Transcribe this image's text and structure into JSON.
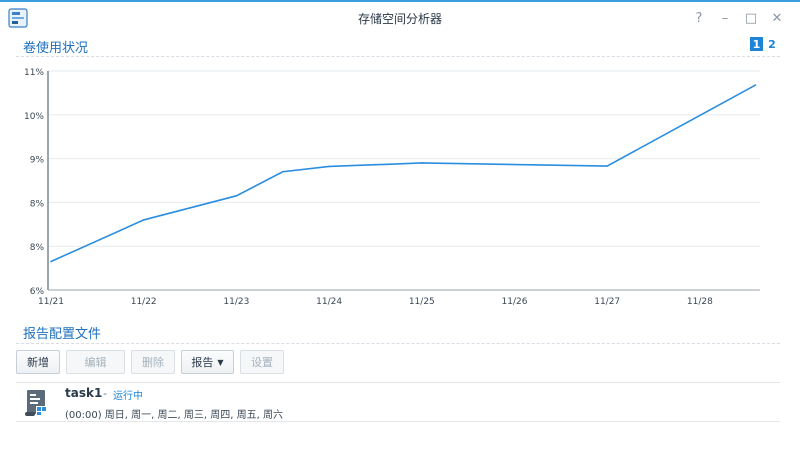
{
  "window": {
    "title": "存储空间分析器",
    "controls": [
      "?",
      "–",
      "□",
      "✕"
    ]
  },
  "usage_section": {
    "title": "卷使用状况",
    "pages": [
      "1",
      "2"
    ],
    "active_page": "1"
  },
  "chart_data": {
    "type": "line",
    "title": "",
    "xlabel": "",
    "ylabel": "",
    "y_tick_labels": [
      "6%",
      "8%",
      "8%",
      "9%",
      "10%",
      "11%"
    ],
    "x_tick_labels": [
      "11/21",
      "11/22",
      "11/23",
      "11/24",
      "11/25",
      "11/26",
      "11/27",
      "11/28"
    ],
    "ylim": [
      6,
      11
    ],
    "grid": true,
    "series": [
      {
        "x": [
          "11/21",
          "11/22",
          "11/23",
          "11/23.5",
          "11/24",
          "11/25",
          "11/27",
          "11/28.6"
        ],
        "x_numeric": [
          0,
          1,
          2,
          2.5,
          3,
          4,
          6,
          7.6
        ],
        "values": [
          6.65,
          7.6,
          8.15,
          8.7,
          8.82,
          8.9,
          8.83,
          10.68
        ]
      }
    ],
    "color": "#2b8ee0"
  },
  "report_section": {
    "title": "报告配置文件"
  },
  "toolbar": {
    "new_label": "新增",
    "edit_label": "编辑",
    "delete_label": "删除",
    "report_label": "报告",
    "settings_label": "设置"
  },
  "task": {
    "name": "task1",
    "separator": "-",
    "status": "运行中",
    "schedule": "(00:00) 周日, 周一, 周二, 周三, 周四, 周五, 周六"
  }
}
